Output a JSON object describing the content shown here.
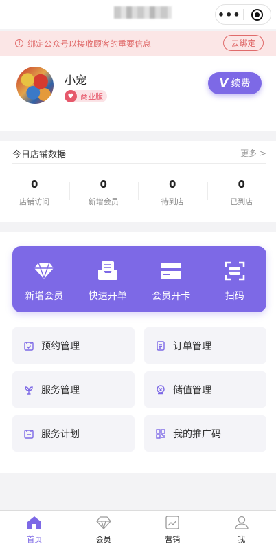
{
  "app": {
    "title": ""
  },
  "colors": {
    "accent": "#7d69e6",
    "notice_bg": "#fbe6e6",
    "notice_text": "#e06b6b",
    "badge": "#e6586b"
  },
  "notice": {
    "text": "绑定公众号以接收顾客的重要信息",
    "button": "去绑定",
    "icon": "info-icon"
  },
  "profile": {
    "name": "小宠",
    "badge": "商业版",
    "badge_icon": "vip-heart-icon",
    "renew_button": "续费",
    "renew_icon": "v-icon"
  },
  "stats": {
    "title": "今日店铺数据",
    "more": "更多 >",
    "items": [
      {
        "value": "0",
        "label": "店铺访问"
      },
      {
        "value": "0",
        "label": "新增会员"
      },
      {
        "value": "0",
        "label": "待到店"
      },
      {
        "value": "0",
        "label": "已到店"
      }
    ]
  },
  "quick_actions": [
    {
      "label": "新增会员",
      "icon": "diamond-icon"
    },
    {
      "label": "快速开单",
      "icon": "inbox-icon"
    },
    {
      "label": "会员开卡",
      "icon": "card-icon"
    },
    {
      "label": "扫码",
      "icon": "scan-icon"
    }
  ],
  "menu": [
    {
      "label": "预约管理",
      "icon": "calendar-check-icon"
    },
    {
      "label": "订单管理",
      "icon": "document-list-icon"
    },
    {
      "label": "服务管理",
      "icon": "service-flower-icon"
    },
    {
      "label": "储值管理",
      "icon": "coin-icon"
    },
    {
      "label": "服务计划",
      "icon": "calendar-icon"
    },
    {
      "label": "我的推广码",
      "icon": "qr-code-icon"
    }
  ],
  "tabs": [
    {
      "label": "首页",
      "icon": "home-icon",
      "active": true
    },
    {
      "label": "会员",
      "icon": "diamond-outline-icon",
      "active": false
    },
    {
      "label": "营销",
      "icon": "chart-icon",
      "active": false
    },
    {
      "label": "我",
      "icon": "person-icon",
      "active": false
    }
  ]
}
